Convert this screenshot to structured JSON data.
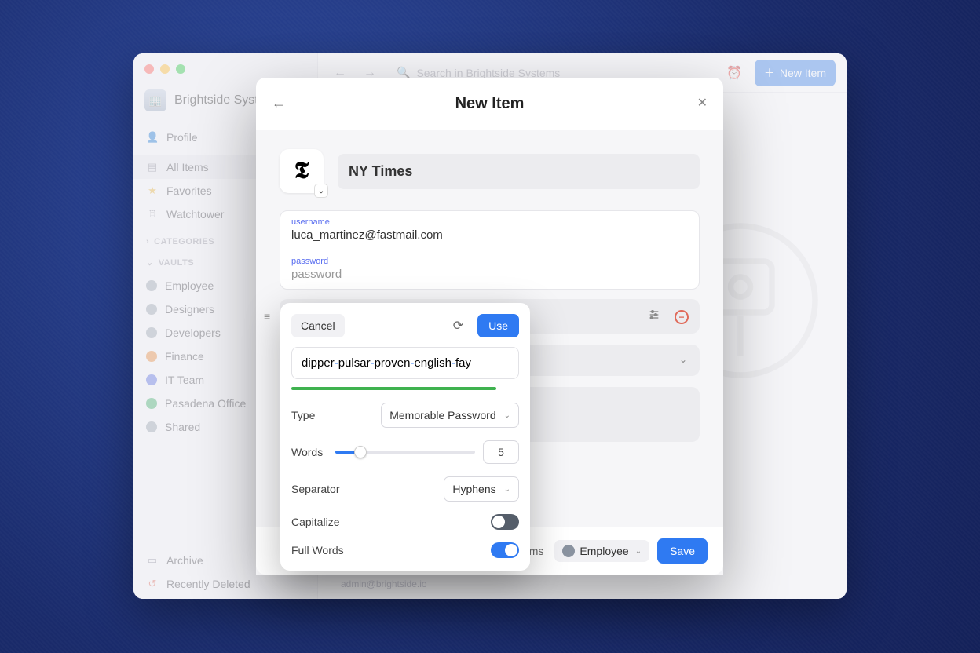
{
  "window": {
    "org_name": "Brightside Syst…",
    "search_placeholder": "Search in Brightside Systems",
    "new_item_button": "New Item"
  },
  "sidebar": {
    "profile": "Profile",
    "primary": [
      {
        "label": "All Items",
        "icon": "▤"
      },
      {
        "label": "Favorites",
        "icon": "★"
      },
      {
        "label": "Watchtower",
        "icon": "♖"
      }
    ],
    "categories_label": "CATEGORIES",
    "vaults_label": "VAULTS",
    "vaults": [
      {
        "label": "Employee",
        "color": "#9aa3ad"
      },
      {
        "label": "Designers",
        "color": "#9aa3ad"
      },
      {
        "label": "Developers",
        "color": "#9aa3ad"
      },
      {
        "label": "Finance",
        "color": "#e68a3a"
      },
      {
        "label": "IT Team",
        "color": "#5b6ee0"
      },
      {
        "label": "Pasadena Office",
        "color": "#3fae6a"
      },
      {
        "label": "Shared",
        "color": "#9aa3ad"
      }
    ],
    "footer": [
      {
        "label": "Archive",
        "icon": "▭"
      },
      {
        "label": "Recently Deleted",
        "icon": "↺"
      }
    ]
  },
  "modal": {
    "title": "New Item",
    "item_title": "NY Times",
    "username_lbl": "username",
    "username_val": "luca_martinez@fastmail.com",
    "password_lbl": "password",
    "password_val": "password",
    "footer_text": "…ems",
    "vault_selected": "Employee",
    "save": "Save",
    "below_email": "admin@brightside.io"
  },
  "generator": {
    "cancel": "Cancel",
    "use": "Use",
    "words": [
      "dipper",
      "pulsar",
      "proven",
      "english",
      "fay"
    ],
    "type_label": "Type",
    "type_value": "Memorable Password",
    "words_label": "Words",
    "word_count": "5",
    "separator_label": "Separator",
    "separator_value": "Hyphens",
    "capitalize_label": "Capitalize",
    "capitalize_on": false,
    "fullwords_label": "Full Words",
    "fullwords_on": true
  }
}
